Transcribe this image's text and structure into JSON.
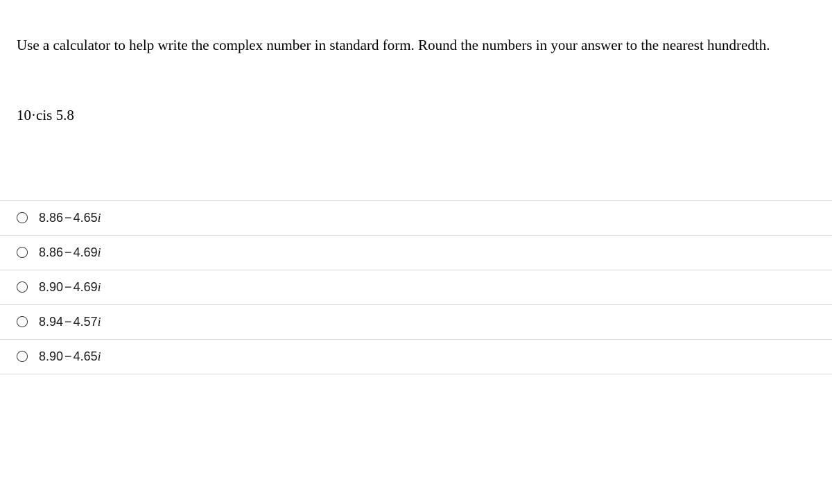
{
  "question": {
    "prompt": "Use a calculator to help write the complex number in standard form. Round the numbers in your answer to the nearest hundredth.",
    "expression": "10·cis 5.8"
  },
  "options": [
    {
      "real": "8.86",
      "imag": "4.65"
    },
    {
      "real": "8.86",
      "imag": "4.69"
    },
    {
      "real": "8.90",
      "imag": "4.69"
    },
    {
      "real": "8.94",
      "imag": "4.57"
    },
    {
      "real": "8.90",
      "imag": "4.65"
    }
  ]
}
